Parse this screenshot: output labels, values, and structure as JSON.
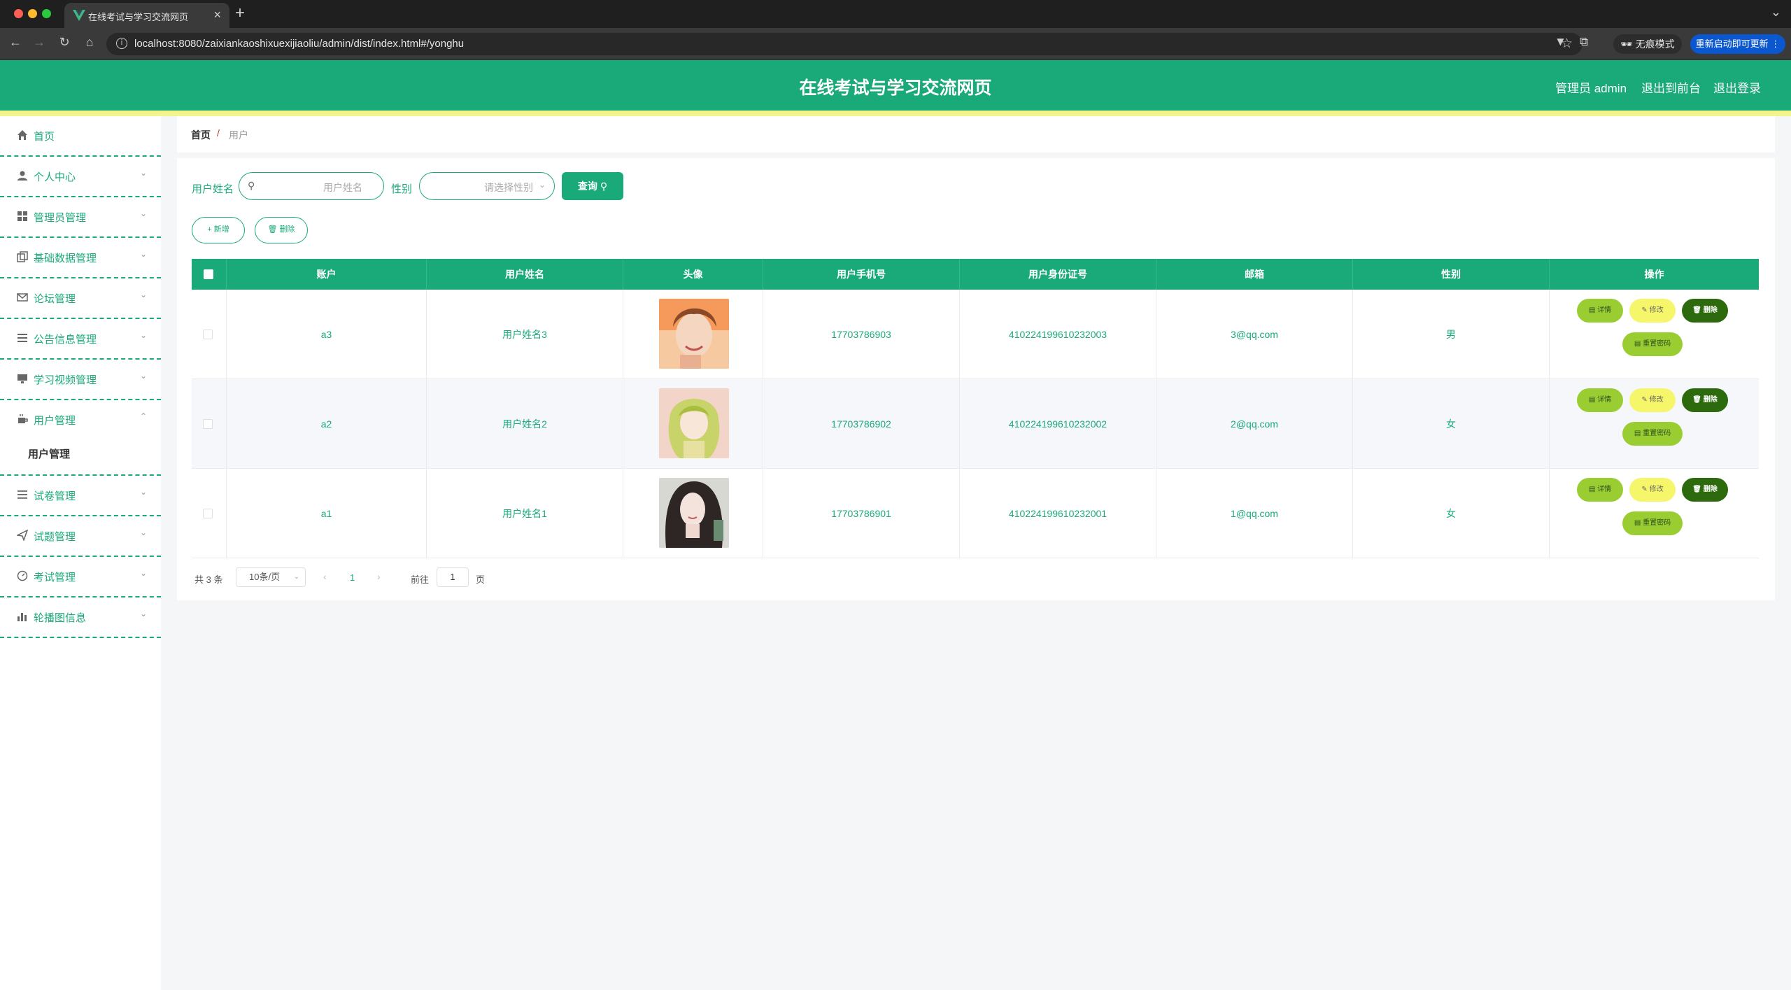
{
  "browser": {
    "tab_title": "在线考试与学习交流网页",
    "url": "localhost:8080/zaixiankaoshixuexijiaoliu/admin/dist/index.html#/yonghu",
    "incognito_label": "无痕模式",
    "update_label": "重新启动即可更新"
  },
  "header": {
    "title": "在线考试与学习交流网页",
    "admin_label": "管理员 admin",
    "back_to_front": "退出到前台",
    "logout": "退出登录"
  },
  "sidebar": {
    "items": [
      {
        "label": "首页",
        "icon": "home-icon"
      },
      {
        "label": "个人中心",
        "icon": "user-icon"
      },
      {
        "label": "管理员管理",
        "icon": "grid-icon"
      },
      {
        "label": "基础数据管理",
        "icon": "copy-icon"
      },
      {
        "label": "论坛管理",
        "icon": "mail-icon"
      },
      {
        "label": "公告信息管理",
        "icon": "list-icon"
      },
      {
        "label": "学习视频管理",
        "icon": "monitor-icon"
      },
      {
        "label": "用户管理",
        "icon": "coffee-icon",
        "expanded": true
      },
      {
        "label": "试卷管理",
        "icon": "menu-icon"
      },
      {
        "label": "试题管理",
        "icon": "send-icon"
      },
      {
        "label": "考试管理",
        "icon": "gauge-icon"
      },
      {
        "label": "轮播图信息",
        "icon": "bar-chart-icon"
      }
    ],
    "submenu_user": "用户管理"
  },
  "breadcrumb": {
    "home": "首页",
    "separator": "/",
    "current": "用户"
  },
  "search": {
    "name_label": "用户姓名",
    "name_placeholder": "用户姓名",
    "gender_label": "性别",
    "gender_placeholder": "请选择性别",
    "query_button": "查询"
  },
  "actions": {
    "add": "新增",
    "delete": "删除"
  },
  "table": {
    "columns": [
      "账户",
      "用户姓名",
      "头像",
      "用户手机号",
      "用户身份证号",
      "邮箱",
      "性别",
      "操作"
    ],
    "rows": [
      {
        "account": "a3",
        "name": "用户姓名3",
        "phone": "17703786903",
        "id_card": "410224199610232003",
        "email": "3@qq.com",
        "gender": "男"
      },
      {
        "account": "a2",
        "name": "用户姓名2",
        "phone": "17703786902",
        "id_card": "410224199610232002",
        "email": "2@qq.com",
        "gender": "女"
      },
      {
        "account": "a1",
        "name": "用户姓名1",
        "phone": "17703786901",
        "id_card": "410224199610232001",
        "email": "1@qq.com",
        "gender": "女"
      }
    ],
    "op_detail": "详情",
    "op_edit": "修改",
    "op_delete": "删除",
    "op_reset": "重置密码"
  },
  "pagination": {
    "total": "共 3 条",
    "page_size": "10条/页",
    "current_page": "1",
    "goto_prefix": "前往",
    "goto_value": "1",
    "goto_suffix": "页"
  },
  "colors": {
    "primary": "#1aaa7a",
    "stripe": "#f3f58a",
    "detail_btn": "#9acd32",
    "edit_btn": "#f6f66b",
    "delete_btn": "#2d6a0e"
  }
}
